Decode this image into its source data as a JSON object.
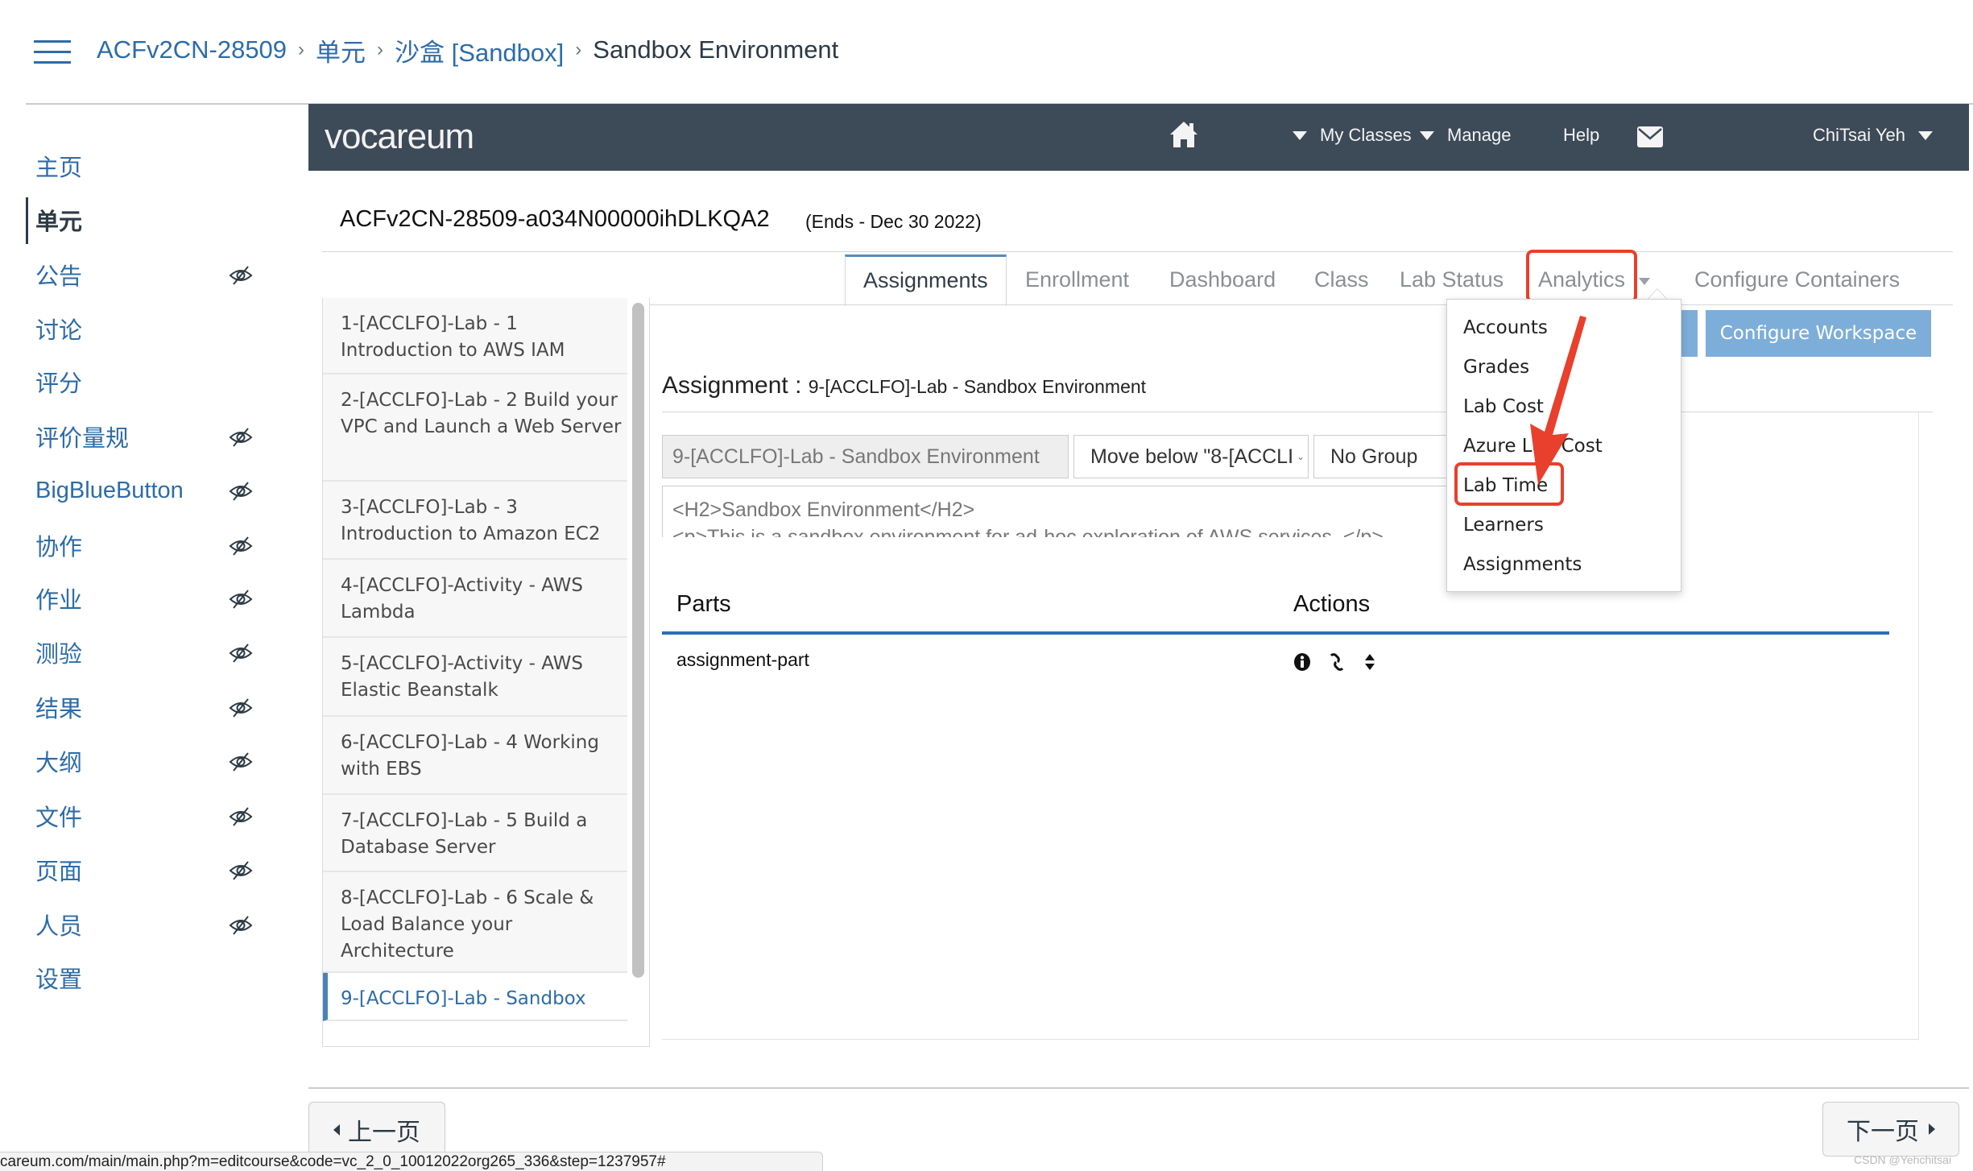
{
  "breadcrumb": {
    "items": [
      "ACFv2CN-28509",
      "单元",
      "沙盒 [Sandbox]"
    ],
    "current": "Sandbox Environment"
  },
  "course_nav": {
    "items": [
      {
        "label": "主页",
        "hidden": false,
        "active": false
      },
      {
        "label": "单元",
        "hidden": false,
        "active": true
      },
      {
        "label": "公告",
        "hidden": true,
        "active": false
      },
      {
        "label": "讨论",
        "hidden": false,
        "active": false
      },
      {
        "label": "评分",
        "hidden": false,
        "active": false
      },
      {
        "label": "评价量规",
        "hidden": true,
        "active": false
      },
      {
        "label": "BigBlueButton",
        "hidden": true,
        "active": false
      },
      {
        "label": "协作",
        "hidden": true,
        "active": false
      },
      {
        "label": "作业",
        "hidden": true,
        "active": false
      },
      {
        "label": "测验",
        "hidden": true,
        "active": false
      },
      {
        "label": "结果",
        "hidden": true,
        "active": false
      },
      {
        "label": "大纲",
        "hidden": true,
        "active": false
      },
      {
        "label": "文件",
        "hidden": true,
        "active": false
      },
      {
        "label": "页面",
        "hidden": true,
        "active": false
      },
      {
        "label": "人员",
        "hidden": true,
        "active": false
      },
      {
        "label": "设置",
        "hidden": false,
        "active": false
      }
    ]
  },
  "navbar": {
    "logo": "vocareum",
    "home_icon": "home-icon",
    "my_classes": "My Classes",
    "manage": "Manage",
    "help": "Help",
    "mail_icon": "envelope-icon",
    "user": "ChiTsai Yeh",
    "bg_color": "#3d4a58"
  },
  "course": {
    "title": "ACFv2CN-28509-a034N00000ihDLKQA2",
    "ends": "(Ends - Dec 30 2022)"
  },
  "tabs": [
    {
      "label": "Assignments",
      "active": true
    },
    {
      "label": "Enrollment",
      "active": false
    },
    {
      "label": "Dashboard",
      "active": false
    },
    {
      "label": "Class",
      "active": false
    },
    {
      "label": "Lab Status",
      "active": false
    },
    {
      "label": "Analytics",
      "active": false,
      "highlighted": true
    },
    {
      "label": "Configure Containers",
      "active": false
    }
  ],
  "analytics_menu": {
    "items": [
      "Accounts",
      "Grades",
      "Lab Cost",
      "Azure Lab Cost",
      "Lab Time",
      "Learners",
      "Assignments"
    ],
    "highlighted": "Lab Time"
  },
  "assignments": {
    "items": [
      "1-[ACCLFO]-Lab - 1 Introduction to AWS IAM",
      "2-[ACCLFO]-Lab - 2 Build your VPC and Launch a Web Server",
      "3-[ACCLFO]-Lab - 3 Introduction to Amazon EC2",
      "4-[ACCLFO]-Activity - AWS Lambda",
      "5-[ACCLFO]-Activity - AWS Elastic Beanstalk",
      "6-[ACCLFO]-Lab - 4 Working with EBS",
      "7-[ACCLFO]-Lab - 5 Build a Database Server",
      "8-[ACCLFO]-Lab - 6 Scale & Load Balance your Architecture",
      "9-[ACCLFO]-Lab - Sandbox"
    ],
    "active_index": 8
  },
  "detail": {
    "configure_workspace": "Configure Workspace",
    "heading_label": "Assignment :",
    "heading_name": "9-[ACCLFO]-Lab - Sandbox Environment",
    "name_field": "9-[ACCLFO]-Lab - Sandbox Environment",
    "move_select": "Move below \"8-[ACCLI",
    "group_select": "No Group",
    "description_line1": "<H2>Sandbox Environment</H2>",
    "description_line2": "<p>This is a sandbox environment for ad-hoc exploration of AWS services. </p>",
    "parts_header": "Parts",
    "actions_header": "Actions",
    "parts": [
      {
        "name": "assignment-part",
        "actions": [
          "info-icon",
          "link-icon",
          "sort-icon"
        ]
      }
    ]
  },
  "pager": {
    "prev": "上一页",
    "next": "下一页"
  },
  "status_url": "careum.com/main/main.php?m=editcourse&code=vc_2_0_10012022org265_336&step=1237957#",
  "watermark": "CSDN @Yehchitsai",
  "colors": {
    "link": "#2d6ca9",
    "accent_blue_button": "#7daed9",
    "annotation_red": "#e8402d",
    "parts_underline": "#2d6dbb"
  }
}
